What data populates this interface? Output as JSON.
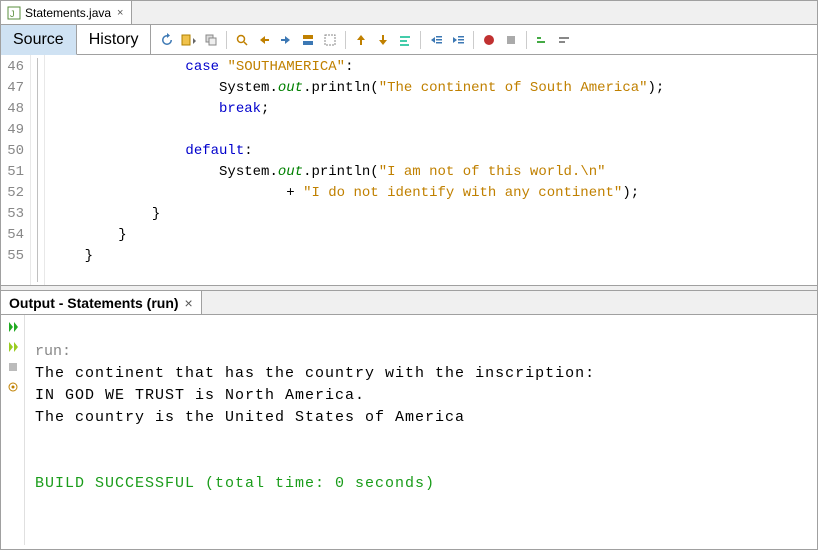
{
  "fileTab": {
    "name": "Statements.java",
    "closeGlyph": "×"
  },
  "subtabs": {
    "source": "Source",
    "history": "History"
  },
  "toolbarIcons": [
    "refresh-icon",
    "paste-dropdown-icon",
    "duplicate-icon",
    "find-icon",
    "find-prev-icon",
    "find-next-icon",
    "replace-icon",
    "select-icon",
    "shift-up-icon",
    "shift-down-icon",
    "reformat-icon",
    "indent-left-icon",
    "indent-right-icon",
    "record-icon",
    "stop-icon",
    "comment-icon",
    "uncomment-icon"
  ],
  "code": {
    "startLine": 46,
    "lines": [
      {
        "n": 46,
        "indent": "                ",
        "tokens": [
          [
            "kw",
            "case"
          ],
          [
            "punct",
            " "
          ],
          [
            "str",
            "\"SOUTHAMERICA\""
          ],
          [
            "punct",
            ":"
          ]
        ]
      },
      {
        "n": 47,
        "indent": "                    ",
        "tokens": [
          [
            "punct",
            "System."
          ],
          [
            "static-it",
            "out"
          ],
          [
            "punct",
            ".println("
          ],
          [
            "str",
            "\"The continent of South America\""
          ],
          [
            "punct",
            ");"
          ]
        ]
      },
      {
        "n": 48,
        "indent": "                    ",
        "tokens": [
          [
            "kw",
            "break"
          ],
          [
            "punct",
            ";"
          ]
        ]
      },
      {
        "n": 49,
        "indent": "",
        "tokens": []
      },
      {
        "n": 50,
        "indent": "                ",
        "tokens": [
          [
            "kw",
            "default"
          ],
          [
            "punct",
            ":"
          ]
        ]
      },
      {
        "n": 51,
        "indent": "                    ",
        "tokens": [
          [
            "punct",
            "System."
          ],
          [
            "static-it",
            "out"
          ],
          [
            "punct",
            ".println("
          ],
          [
            "str",
            "\"I am not of this world.\\n\""
          ]
        ]
      },
      {
        "n": 52,
        "indent": "                            ",
        "tokens": [
          [
            "punct",
            "+ "
          ],
          [
            "str",
            "\"I do not identify with any continent\""
          ],
          [
            "punct",
            ");"
          ]
        ]
      },
      {
        "n": 53,
        "indent": "            ",
        "tokens": [
          [
            "punct",
            "}"
          ]
        ]
      },
      {
        "n": 54,
        "indent": "        ",
        "tokens": [
          [
            "punct",
            "}"
          ]
        ]
      },
      {
        "n": 55,
        "indent": "    ",
        "tokens": [
          [
            "punct",
            "}"
          ]
        ]
      }
    ]
  },
  "output": {
    "title": "Output - Statements (run)",
    "closeGlyph": "×",
    "lines": {
      "run": "run:",
      "l1": "The continent that has the country with the inscription:",
      "l2": "IN GOD WE TRUST is North America.",
      "l3": "The country is the United States of America",
      "blank": "",
      "build": "BUILD SUCCESSFUL (total time: 0 seconds)"
    }
  }
}
